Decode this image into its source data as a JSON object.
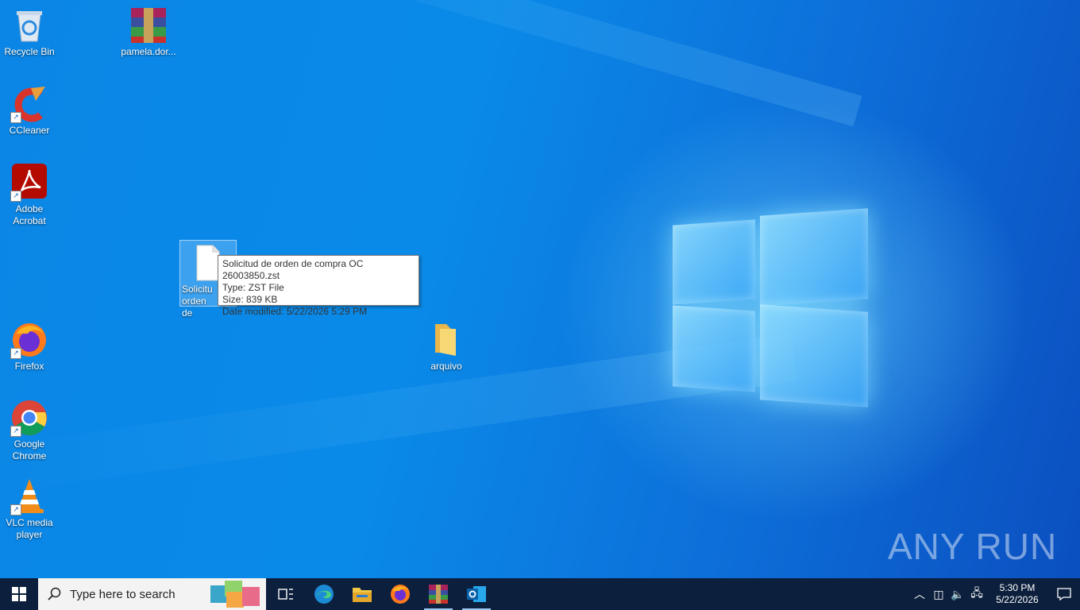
{
  "desktop": {
    "icons": [
      {
        "label": "Recycle Bin"
      },
      {
        "label": "pamela.dor..."
      },
      {
        "label": "CCleaner"
      },
      {
        "label": "Adobe Acrobat"
      },
      {
        "label": "Solicitud de orden de compra OC 26003850.zst",
        "short_label": "Solicitu orden de"
      },
      {
        "label": "Firefox"
      },
      {
        "label": "arquivo"
      },
      {
        "label": "Google Chrome"
      },
      {
        "label": "VLC media player"
      }
    ],
    "tooltip": {
      "line1": "Solicitud de orden de compra OC 26003850.zst",
      "line2": "Type: ZST File",
      "line3": "Size: 839 KB",
      "line4": "Date modified: 5/22/2026 5:29 PM"
    },
    "watermark": "ANY RUN"
  },
  "taskbar": {
    "search_placeholder": "Type here to search",
    "apps": [
      "task-view",
      "edge",
      "file-explorer",
      "firefox",
      "winrar",
      "outlook"
    ],
    "clock": {
      "time": "5:30 PM",
      "date": "5/22/2026"
    }
  },
  "colors": {
    "accent": "#0a8ae8",
    "taskbar": "#0c1f3c"
  }
}
